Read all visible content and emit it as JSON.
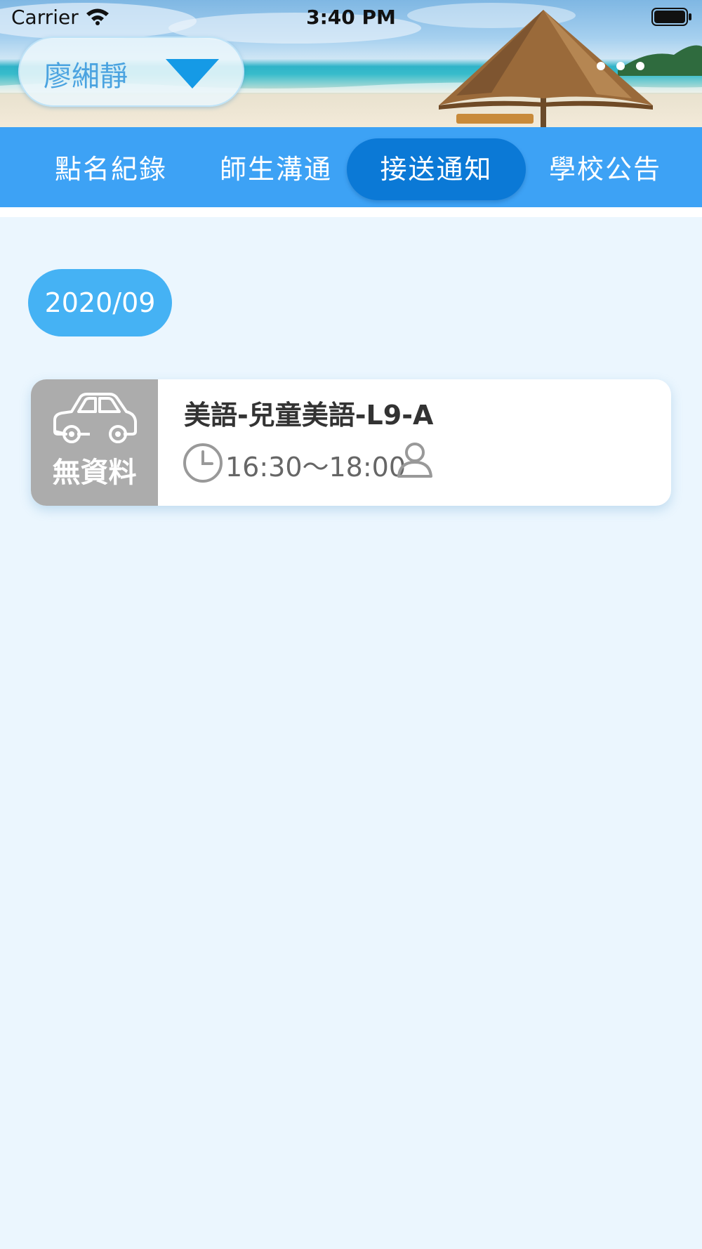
{
  "status_bar": {
    "carrier": "Carrier",
    "time": "3:40 PM"
  },
  "header": {
    "student_name": "廖緗靜",
    "icons": [
      "wifi-icon",
      "battery-icon",
      "dropdown-triangle-icon"
    ]
  },
  "tabs": [
    {
      "label": "點名紀錄",
      "active": false
    },
    {
      "label": "師生溝通",
      "active": false
    },
    {
      "label": "接送通知",
      "active": true
    },
    {
      "label": "學校公告",
      "active": false
    }
  ],
  "month": "2020/09",
  "records": [
    {
      "status_label": "無資料",
      "status_icon": "car-icon",
      "title": "美語-兒童美語-L9-A",
      "time": "16:30～18:00",
      "icons": [
        "clock-icon",
        "person-icon"
      ]
    }
  ],
  "colors": {
    "page_background": "#ebf6fe",
    "tab_bar": "#3da2f5",
    "active_tab": "#0b79d6",
    "month_pill": "#45b2f4",
    "status_gray": "#acacac"
  }
}
